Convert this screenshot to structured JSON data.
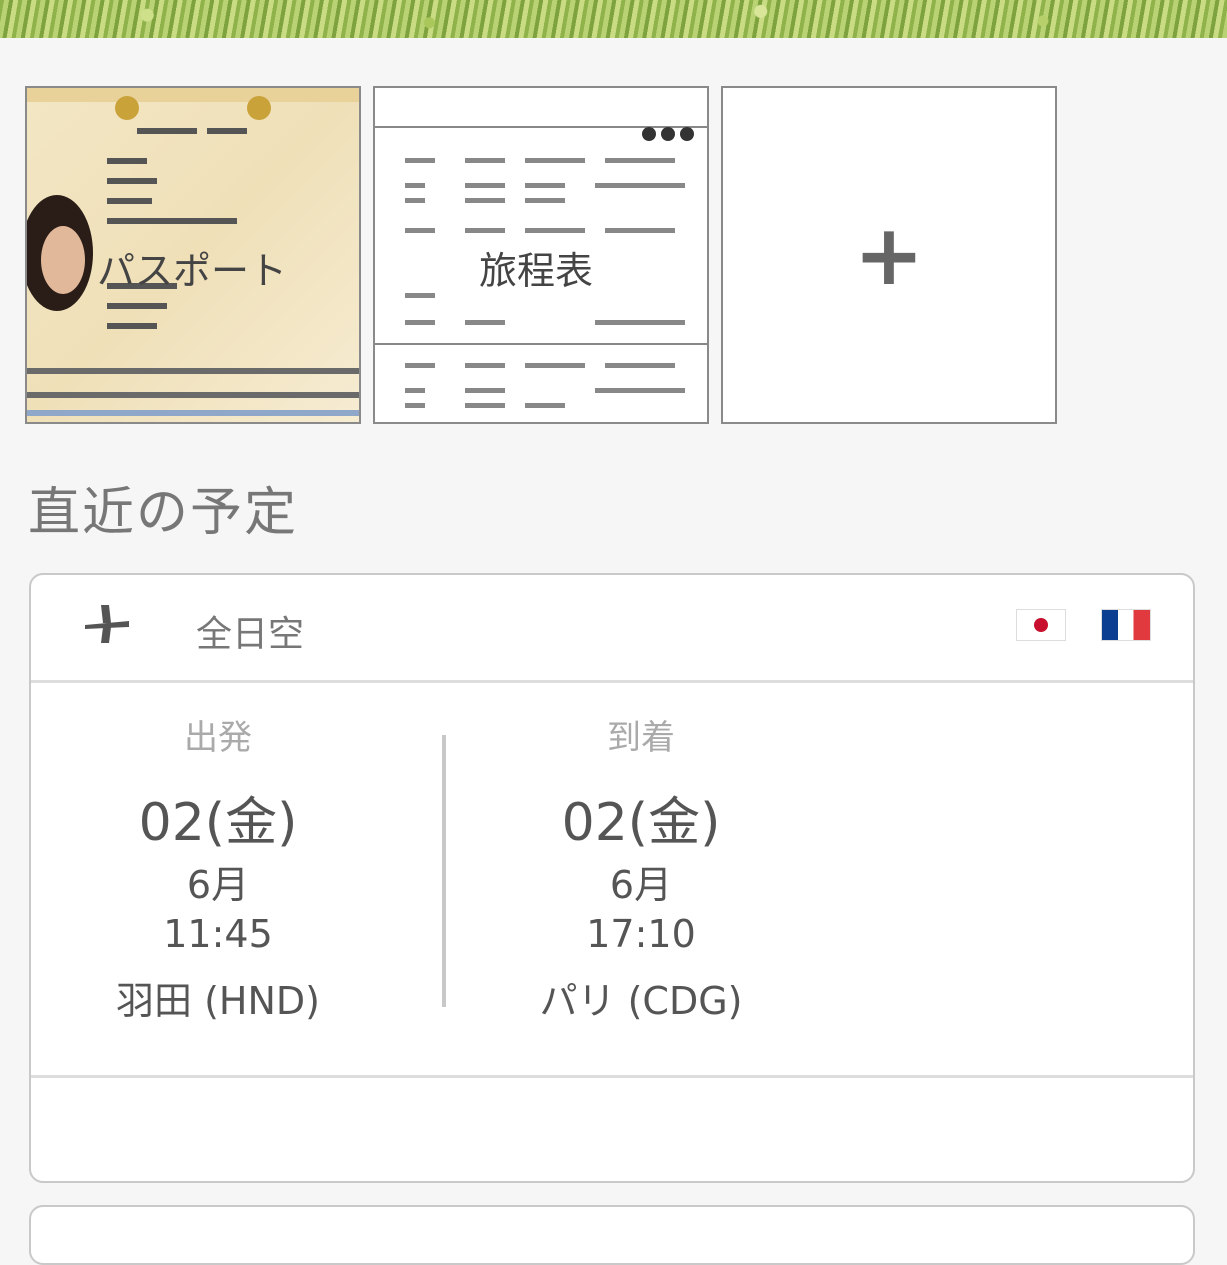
{
  "thumbnails": {
    "passport_caption": "パスポート",
    "itinerary_caption": "旅程表",
    "add_symbol": "+"
  },
  "section_title": "直近の予定",
  "flight": {
    "airline": "全日空",
    "departure": {
      "label": "出発",
      "date": "02(金)",
      "month": "6月",
      "time": "11:45",
      "airport": "羽田 (HND)"
    },
    "arrival": {
      "label": "到着",
      "date": "02(金)",
      "month": "6月",
      "time": "17:10",
      "airport": "パリ (CDG)"
    },
    "flags": [
      "jp-flag-icon",
      "fr-flag-icon"
    ]
  }
}
